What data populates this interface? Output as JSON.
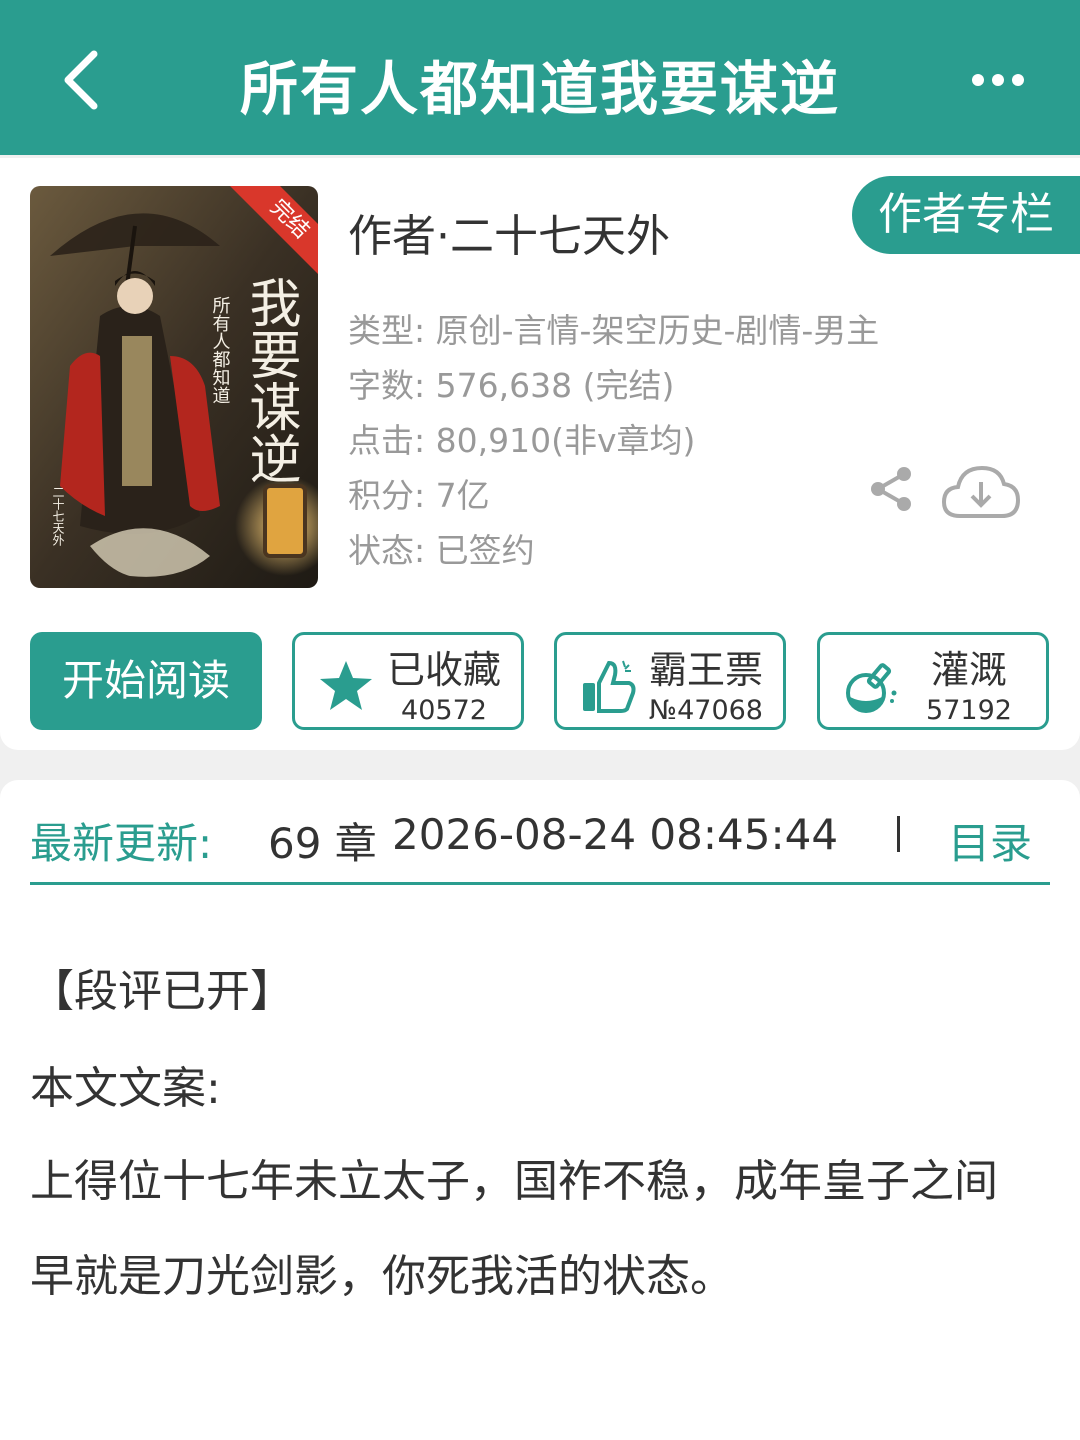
{
  "header": {
    "title": "所有人都知道我要谋逆",
    "back_icon": "chevron-left-icon",
    "more_icon": "more-dots-icon"
  },
  "book": {
    "cover": {
      "badge": "完结",
      "title_art": "我要谋逆",
      "subtitle_art": "所有人都知道",
      "author_art": "二十七天外"
    },
    "author_line": "作者·二十七天外",
    "author_column_label": "作者专栏",
    "meta": [
      {
        "label": "类型:",
        "value": "原创-言情-架空历史-剧情-男主"
      },
      {
        "label": "字数:",
        "value": "576,638 (完结)"
      },
      {
        "label": "点击:",
        "value": "80,910(非v章均)"
      },
      {
        "label": "积分:",
        "value": "7亿"
      },
      {
        "label": "状态:",
        "value": "已签约"
      }
    ]
  },
  "actions": {
    "read_label": "开始阅读",
    "favorite": {
      "label": "已收藏",
      "count": "40572",
      "icon": "star-icon"
    },
    "vote": {
      "label": "霸王票",
      "count": "№47068",
      "icon": "thumbs-up-icon"
    },
    "nutrient": {
      "label": "灌溉",
      "count": "57192",
      "icon": "watering-flask-icon"
    }
  },
  "update": {
    "label": "最新更新:",
    "chapter": "69 章",
    "time": "2026-08-24 08:45:44",
    "toc_label": "目录"
  },
  "description": {
    "notice": "【段评已开】",
    "heading": "本文文案:",
    "line1": "上得位十七年未立太子，国祚不稳，成年皇子之间",
    "line2": "早就是刀光剑影，你死我活的状态。"
  },
  "colors": {
    "accent": "#2a9d8f",
    "meta_text": "#999999",
    "body_text": "#333333"
  }
}
